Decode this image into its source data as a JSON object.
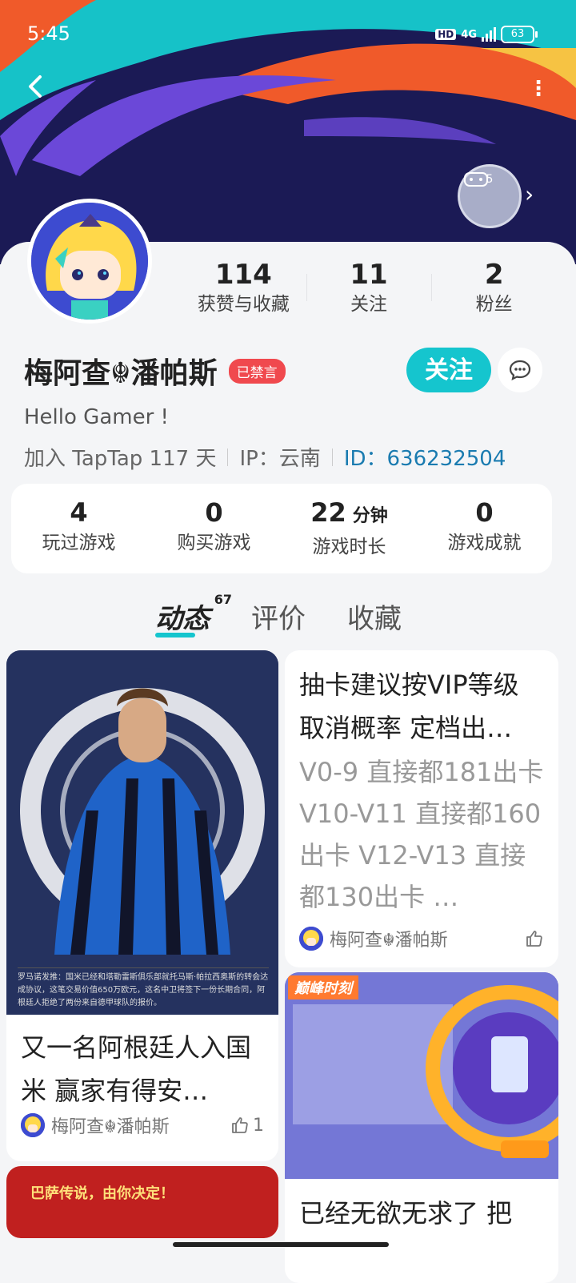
{
  "status_bar": {
    "time": "5:45",
    "hd": "HD",
    "network": "4G",
    "battery": "63"
  },
  "header": {
    "level_number": "5"
  },
  "profile": {
    "username": "梅阿查☬潘帕斯",
    "banned_badge": "已禁言",
    "bio": "Hello Gamer !",
    "join_info": "加入 TapTap 117 天",
    "ip_info": "IP：云南",
    "id_info": "ID：636232504",
    "follow_button": "关注"
  },
  "stats": [
    {
      "value": "114",
      "label": "获赞与收藏"
    },
    {
      "value": "11",
      "label": "关注"
    },
    {
      "value": "2",
      "label": "粉丝"
    }
  ],
  "game_stats": [
    {
      "value": "4",
      "unit": "",
      "label": "玩过游戏"
    },
    {
      "value": "0",
      "unit": "",
      "label": "购买游戏"
    },
    {
      "value": "22",
      "unit": "分钟",
      "label": "游戏时长"
    },
    {
      "value": "0",
      "unit": "",
      "label": "游戏成就"
    }
  ],
  "tabs": [
    {
      "label": "动态",
      "count": "67"
    },
    {
      "label": "评价"
    },
    {
      "label": "收藏"
    }
  ],
  "feed": {
    "card1": {
      "image_caption": "罗马诺发推：国米已经和塔勒雷斯俱乐部就托马斯·帕拉西奥斯的转会达成协议，这笔交易价值650万欧元，这名中卫将签下一份长期合同，阿根廷人拒绝了两份来自德甲球队的报价。",
      "title": "又一名阿根廷人入国米 赢家有得安…",
      "author": "梅阿查☬潘帕斯",
      "likes": "1"
    },
    "card2": {
      "title": "抽卡建议按VIP等级取消概率 定档出…",
      "body": "V0-9 直接都181出卡 V10-V11 直接都160出卡 V12-V13 直接都130出卡 …",
      "author": "梅阿查☬潘帕斯"
    },
    "card3": {
      "image_label": "巅峰时刻",
      "title": "已经无欲无求了 把"
    },
    "card4": {
      "image_label": "巴萨传说，由你决定！"
    }
  }
}
